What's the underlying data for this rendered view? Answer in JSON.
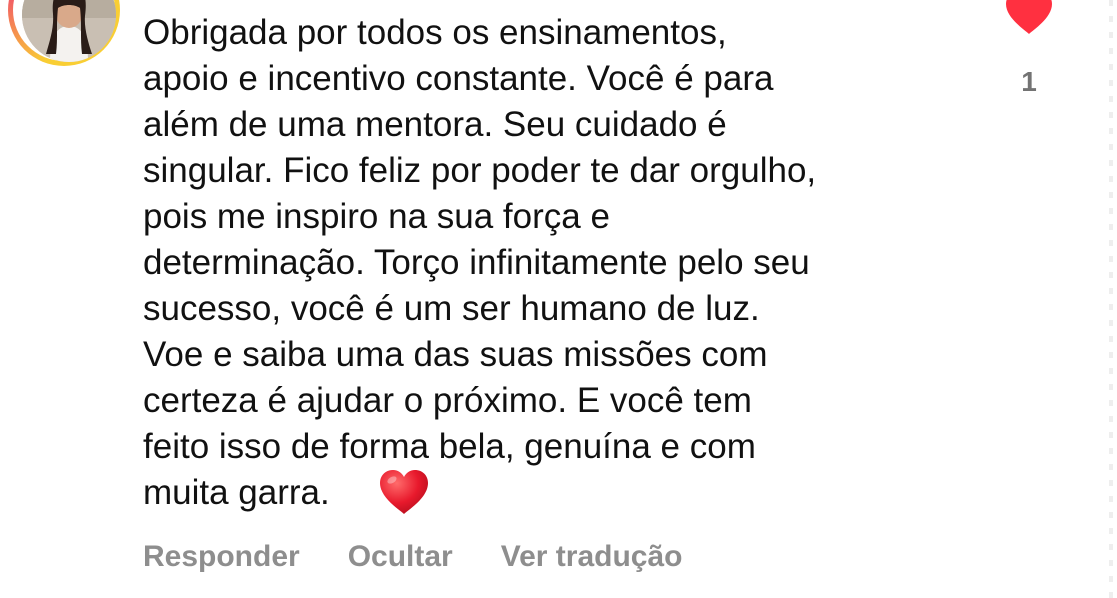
{
  "comment": {
    "text": "Obrigada por todos os ensinamentos,\napoio e incentivo constante. Você é para\nalém de uma mentora. Seu cuidado é\nsingular. Fico feliz por poder te dar orgulho,\npois me inspiro na sua força e\ndeterminação. Torço infinitamente pelo seu\nsucesso, você é um ser humano de luz.\nVoe e saiba uma das suas missões com\ncerteza é ajudar o próximo. E você tem\nfeito isso de forma bela, genuína e com\nmuita garra. ",
    "emoji": "red-heart-emoji",
    "like_count": "1"
  },
  "actions": {
    "reply_label": "Responder",
    "hide_label": "Ocultar",
    "translate_label": "Ver tradução"
  },
  "colors": {
    "like_heart": "#ff3040",
    "action_text": "#8e8e8e",
    "like_count": "#737373",
    "story_ring_start": "#f9ce34",
    "story_ring_end": "#ee2a7b"
  },
  "icons": {
    "like": "heart-filled-icon",
    "avatar": "user-avatar"
  }
}
